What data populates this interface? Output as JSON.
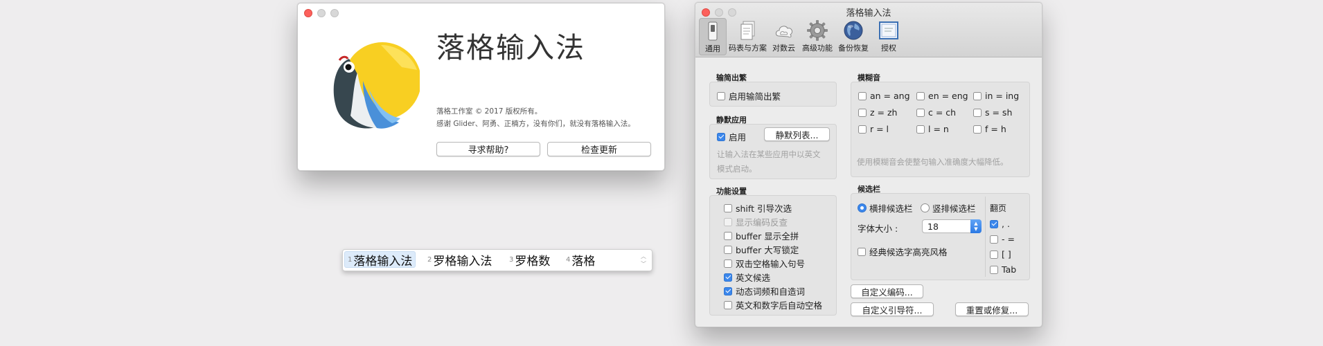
{
  "about": {
    "title": "落格输入法",
    "copyright": "落格工作室 © 2017 版权所有。",
    "thanks": "感谢 Glider、阿勇、正楠方，没有你们，就没有落格输入法。",
    "help_button": "寻求帮助?",
    "update_button": "检查更新"
  },
  "candidates": [
    {
      "num": "1",
      "word": "落格输入法"
    },
    {
      "num": "2",
      "word": "罗格输入法"
    },
    {
      "num": "3",
      "word": "罗格数"
    },
    {
      "num": "4",
      "word": "落格"
    }
  ],
  "prefs": {
    "title": "落格输入法",
    "toolbar": [
      "通用",
      "码表与方案",
      "对数云",
      "高级功能",
      "备份恢复",
      "授权"
    ],
    "jianfan": {
      "title": "输简出繁",
      "option": "启用输简出繁"
    },
    "silent": {
      "title": "静默应用",
      "enable": "启用",
      "list_button": "静默列表...",
      "hint1": "让输入法在某些应用中以英文",
      "hint2": "模式启动。"
    },
    "features": {
      "title": "功能设置",
      "items": [
        {
          "label": "shift 引导次选",
          "checked": false
        },
        {
          "label": "显示编码反查",
          "checked": false
        },
        {
          "label": "buffer 显示全拼",
          "checked": false
        },
        {
          "label": "buffer 大写锁定",
          "checked": false
        },
        {
          "label": "双击空格输入句号",
          "checked": false
        },
        {
          "label": "英文候选",
          "checked": true
        },
        {
          "label": "动态词频和自造词",
          "checked": true
        },
        {
          "label": "英文和数字后自动空格",
          "checked": false
        }
      ]
    },
    "fuzzy": {
      "title": "模糊音",
      "items": [
        "an = ang",
        "en = eng",
        "in = ing",
        "z = zh",
        "c = ch",
        "s = sh",
        "r = l",
        "l = n",
        "f = h"
      ],
      "hint": "使用模糊音会使整句输入准确度大幅降低。"
    },
    "candbar": {
      "title": "候选栏",
      "horizontal": "横排候选栏",
      "vertical": "竖排候选栏",
      "font_size_label": "字体大小 :",
      "font_size": "18",
      "classic": "经典候选字高亮风格",
      "page_title": "翻页",
      "page_keys": [
        ", .",
        "- =",
        "[ ]",
        "Tab"
      ]
    },
    "custom_code_button": "自定义编码...",
    "custom_guide_button": "自定义引导符...",
    "reset_button": "重置或修复..."
  },
  "colors": {
    "accent": "#3b87ec",
    "close": "#fc605c"
  }
}
